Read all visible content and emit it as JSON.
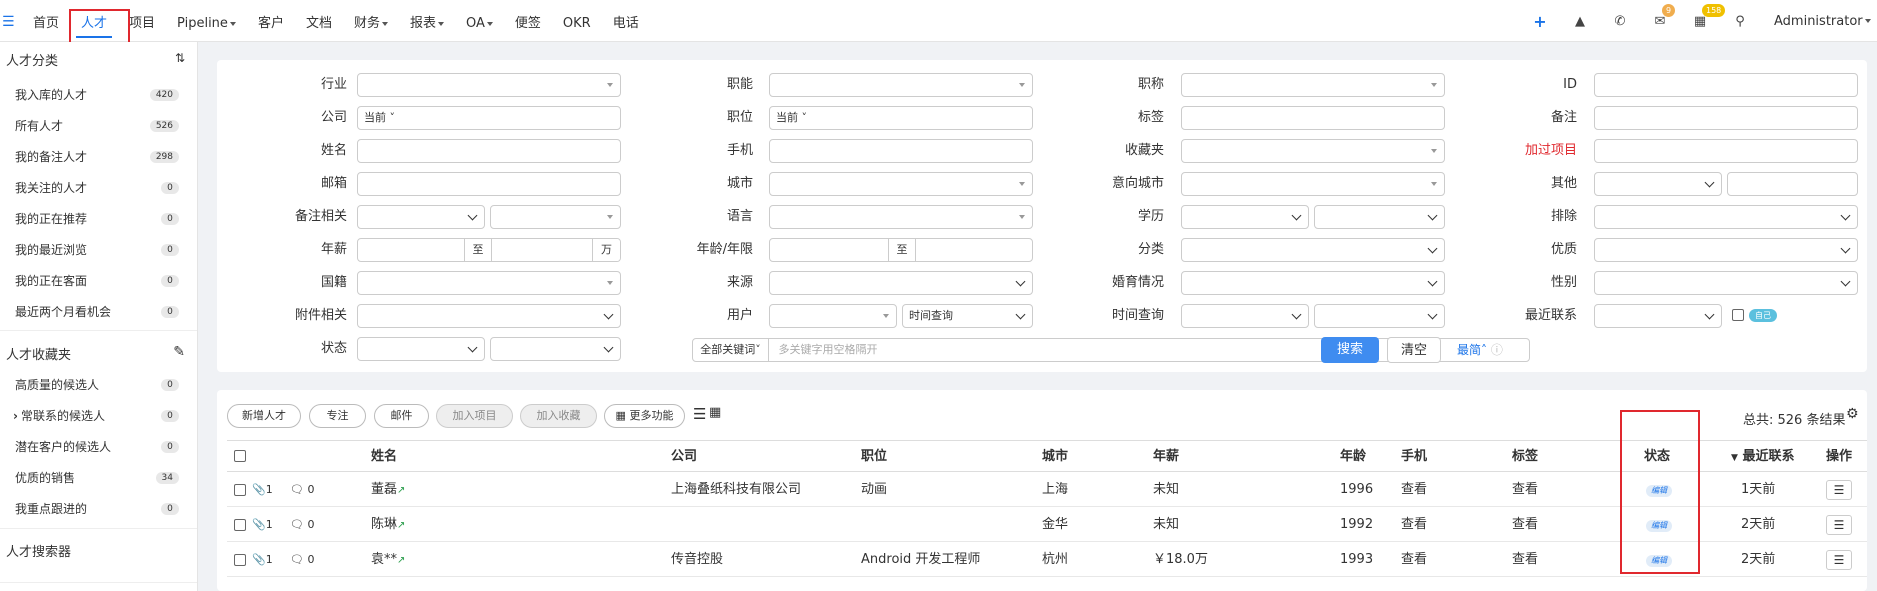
{
  "nav": {
    "items": [
      {
        "label": "首页",
        "caret": false
      },
      {
        "label": "人才",
        "caret": false,
        "active": true
      },
      {
        "label": "项目",
        "caret": false
      },
      {
        "label": "Pipeline",
        "caret": true
      },
      {
        "label": "客户",
        "caret": false
      },
      {
        "label": "文档",
        "caret": false
      },
      {
        "label": "财务",
        "caret": true
      },
      {
        "label": "报表",
        "caret": true
      },
      {
        "label": "OA",
        "caret": true
      },
      {
        "label": "便签",
        "caret": false
      },
      {
        "label": "OKR",
        "caret": false
      },
      {
        "label": "电话",
        "caret": false
      }
    ],
    "mail_badge": "9",
    "calendar_badge": "158",
    "user": "Administrator",
    "accent": "#1a73e8"
  },
  "sidebar": {
    "section1_title": "人才分类",
    "items1": [
      {
        "label": "我入库的人才",
        "count": "420"
      },
      {
        "label": "所有人才",
        "count": "526"
      },
      {
        "label": "我的备注人才",
        "count": "298"
      },
      {
        "label": "我关注的人才",
        "count": "0"
      },
      {
        "label": "我的正在推荐",
        "count": "0"
      },
      {
        "label": "我的最近浏览",
        "count": "0"
      },
      {
        "label": "我的正在客面",
        "count": "0"
      },
      {
        "label": "最近两个月看机会",
        "count": "0"
      }
    ],
    "section2_title": "人才收藏夹",
    "items2": [
      {
        "label": "高质量的候选人",
        "count": "0"
      },
      {
        "label": "常联系的候选人",
        "count": "0"
      },
      {
        "label": "潜在客户的候选人",
        "count": "0"
      },
      {
        "label": "优质的销售",
        "count": "34"
      },
      {
        "label": "我重点跟进的",
        "count": "0"
      }
    ],
    "section3_title": "人才搜索器"
  },
  "filters": {
    "labels": {
      "industry": "行业",
      "function": "职能",
      "title": "职称",
      "id": "ID",
      "company": "公司",
      "position": "职位",
      "tag": "标签",
      "note": "备注",
      "name": "姓名",
      "mobile": "手机",
      "favorites": "收藏夹",
      "joined_project": "加过项目",
      "email": "邮箱",
      "city": "城市",
      "target_city": "意向城市",
      "other": "其他",
      "note_related": "备注相关",
      "language": "语言",
      "education": "学历",
      "exclude": "排除",
      "salary": "年薪",
      "age_years": "年龄/年限",
      "category": "分类",
      "quality": "优质",
      "nationality": "国籍",
      "source": "来源",
      "marital": "婚育情况",
      "gender": "性别",
      "attachment": "附件相关",
      "user": "用户",
      "time_query": "时间查询",
      "recent_contact": "最近联系",
      "status": "状态"
    },
    "company_value": "当前",
    "position_value": "当前",
    "range_sep": "至",
    "salary_unit": "万",
    "user_time_placeholder": "时间查询",
    "self_tag": "自己",
    "keyword_scope": "全部关键词",
    "keyword_placeholder": "多关键字用空格隔开",
    "search_button": "搜索",
    "clear_button": "清空",
    "simple_link": "最简"
  },
  "toolbar": {
    "new_talent": "新增人才",
    "follow": "专注",
    "email": "邮件",
    "add_project": "加入项目",
    "add_favorite": "加入收藏",
    "more": "更多功能",
    "total": "总共: 526 条结果"
  },
  "table": {
    "headers": {
      "name": "姓名",
      "company": "公司",
      "position": "职位",
      "city": "城市",
      "salary": "年薪",
      "age": "年龄",
      "mobile": "手机",
      "tag": "标签",
      "status": "状态",
      "recent": "最近联系",
      "ops": "操作"
    },
    "rows": [
      {
        "attach": "1",
        "comments": "0",
        "name": "董磊",
        "company": "上海叠纸科技有限公司",
        "position": "动画",
        "city": "上海",
        "salary": "未知",
        "age": "1996",
        "mobile": "查看",
        "tag": "查看",
        "status": "编辑",
        "recent": "1天前"
      },
      {
        "attach": "1",
        "comments": "0",
        "name": "陈琳",
        "company": "",
        "position": "",
        "city": "金华",
        "salary": "未知",
        "age": "1992",
        "mobile": "查看",
        "tag": "查看",
        "status": "编辑",
        "recent": "2天前"
      },
      {
        "attach": "1",
        "comments": "0",
        "name": "袁**",
        "company": "传音控股",
        "position": "Android 开发工程师",
        "city": "杭州",
        "salary": "￥18.0万",
        "age": "1993",
        "mobile": "查看",
        "tag": "查看",
        "status": "编辑",
        "recent": "2天前"
      }
    ]
  }
}
